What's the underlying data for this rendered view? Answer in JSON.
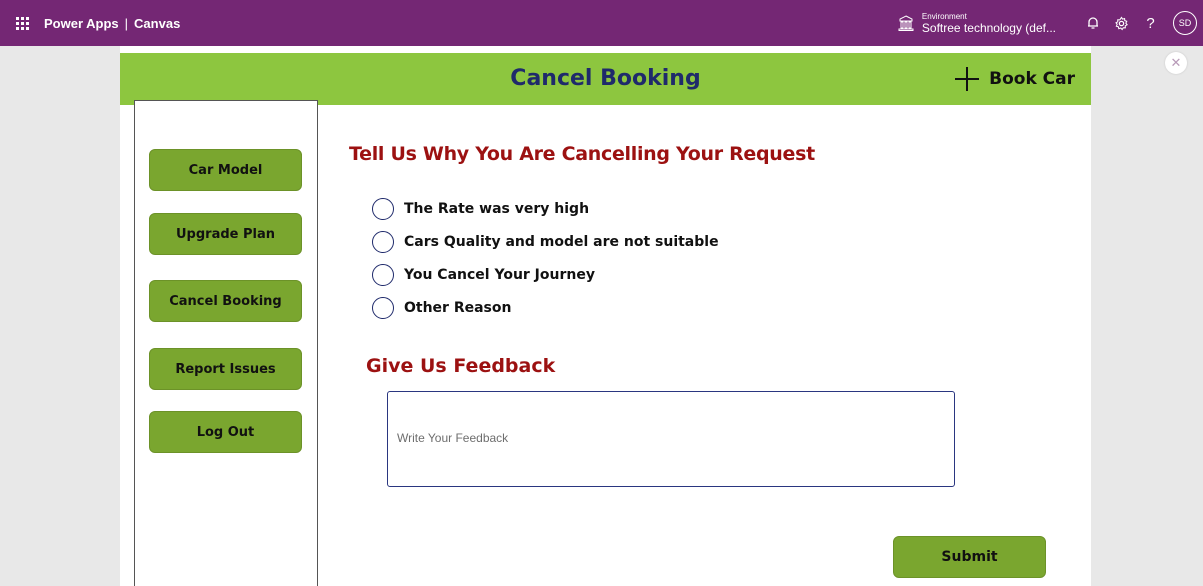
{
  "colors": {
    "brand": "#742774",
    "header_green": "#8dc63f",
    "button_green": "#7aa62f",
    "accent_red": "#9c1111",
    "title_navy": "#1f2a6b"
  },
  "topbar": {
    "app_name": "Power Apps",
    "separator": "|",
    "mode": "Canvas",
    "environment_label": "Environment",
    "environment_name": "Softree technology (def...",
    "avatar_initials": "SD",
    "icons": [
      "waffle-icon",
      "environment-icon",
      "bell-icon",
      "gear-icon",
      "help-icon"
    ]
  },
  "header": {
    "title": "Cancel Booking",
    "book_car_label": "Book Car"
  },
  "sidebar": {
    "items": [
      {
        "label": "Car Model"
      },
      {
        "label": "Upgrade Plan"
      },
      {
        "label": "Cancel Booking"
      },
      {
        "label": "Report Issues"
      },
      {
        "label": "Log Out"
      }
    ]
  },
  "main": {
    "question_title": "Tell Us Why You Are Cancelling Your Request",
    "options": [
      {
        "label": "The Rate was very high"
      },
      {
        "label": "Cars Quality and model are not suitable"
      },
      {
        "label": "You Cancel Your Journey"
      },
      {
        "label": "Other Reason"
      }
    ],
    "feedback_title": "Give Us Feedback",
    "feedback_placeholder": "Write Your Feedback",
    "feedback_value": "",
    "submit_label": "Submit"
  }
}
